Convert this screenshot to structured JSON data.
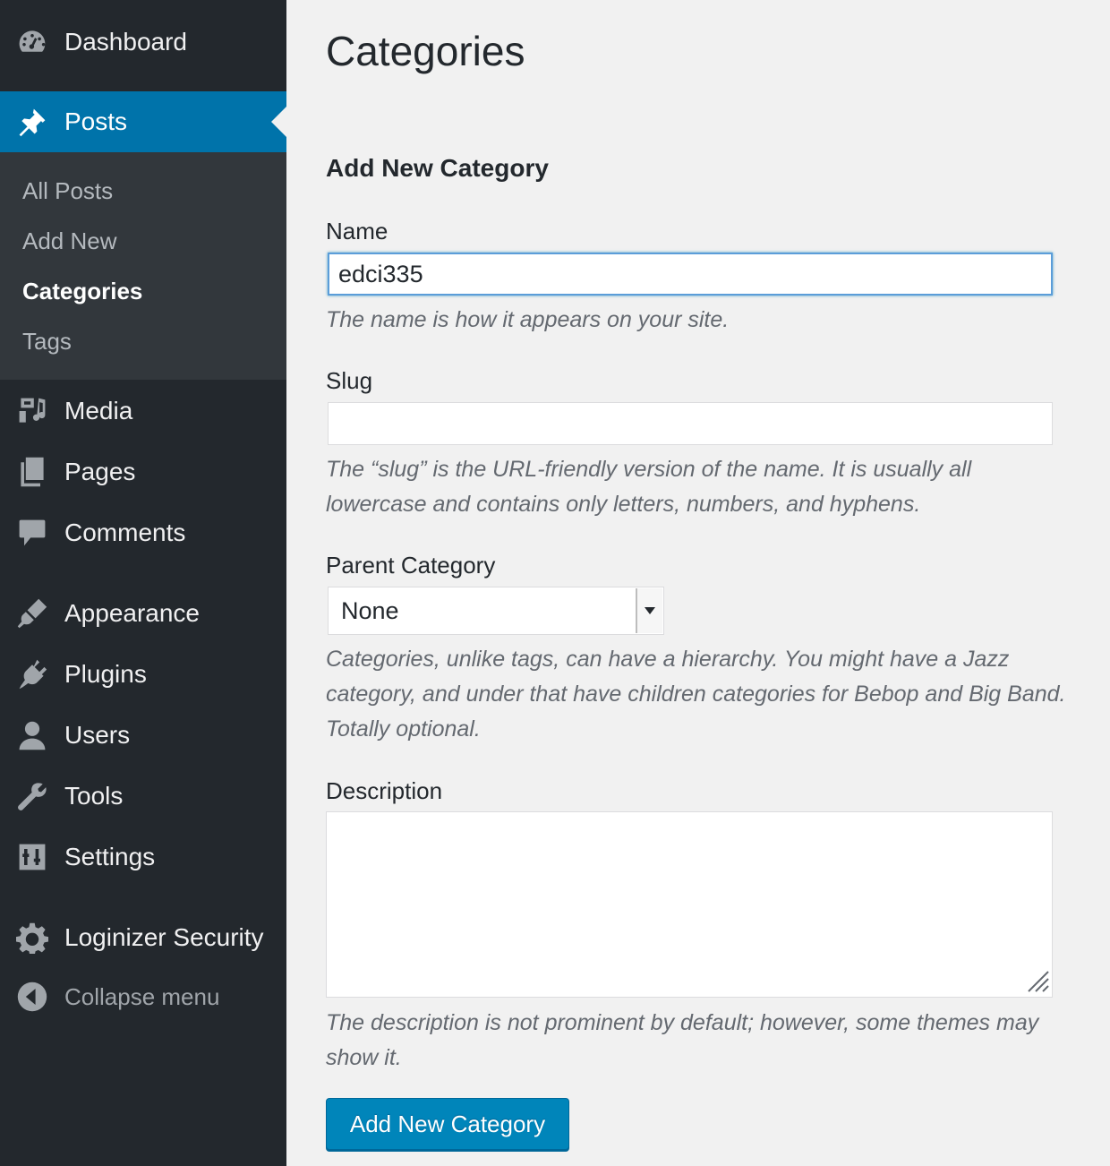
{
  "sidebar": {
    "items": [
      {
        "id": "dashboard",
        "label": "Dashboard",
        "icon": "dashboard-icon"
      },
      {
        "id": "posts",
        "label": "Posts",
        "icon": "pin-icon",
        "current": true
      },
      {
        "id": "media",
        "label": "Media",
        "icon": "media-icon"
      },
      {
        "id": "pages",
        "label": "Pages",
        "icon": "pages-icon"
      },
      {
        "id": "comments",
        "label": "Comments",
        "icon": "comment-icon"
      },
      {
        "id": "appearance",
        "label": "Appearance",
        "icon": "paintbrush-icon"
      },
      {
        "id": "plugins",
        "label": "Plugins",
        "icon": "plug-icon"
      },
      {
        "id": "users",
        "label": "Users",
        "icon": "user-icon"
      },
      {
        "id": "tools",
        "label": "Tools",
        "icon": "wrench-icon"
      },
      {
        "id": "settings",
        "label": "Settings",
        "icon": "sliders-icon"
      },
      {
        "id": "loginizer",
        "label": "Loginizer Security",
        "icon": "gear-icon"
      }
    ],
    "submenu": [
      {
        "label": "All Posts"
      },
      {
        "label": "Add New"
      },
      {
        "label": "Categories",
        "active": true
      },
      {
        "label": "Tags"
      }
    ],
    "collapse_label": "Collapse menu"
  },
  "page": {
    "title": "Categories",
    "form_title": "Add New Category"
  },
  "form": {
    "name": {
      "label": "Name",
      "value": "edci335",
      "help": "The name is how it appears on your site."
    },
    "slug": {
      "label": "Slug",
      "value": "",
      "help": "The “slug” is the URL-friendly version of the name. It is usually all lowercase and contains only letters, numbers, and hyphens."
    },
    "parent": {
      "label": "Parent Category",
      "selected": "None",
      "help": "Categories, unlike tags, can have a hierarchy. You might have a Jazz category, and under that have children categories for Bebop and Big Band. Totally optional."
    },
    "description": {
      "label": "Description",
      "value": "",
      "help": "The description is not prominent by default; however, some themes may show it."
    },
    "submit_label": "Add New Category"
  },
  "colors": {
    "sidebar_bg": "#23282d",
    "submenu_bg": "#32373c",
    "accent": "#0073aa",
    "button": "#0085ba",
    "page_bg": "#f1f1f1"
  }
}
